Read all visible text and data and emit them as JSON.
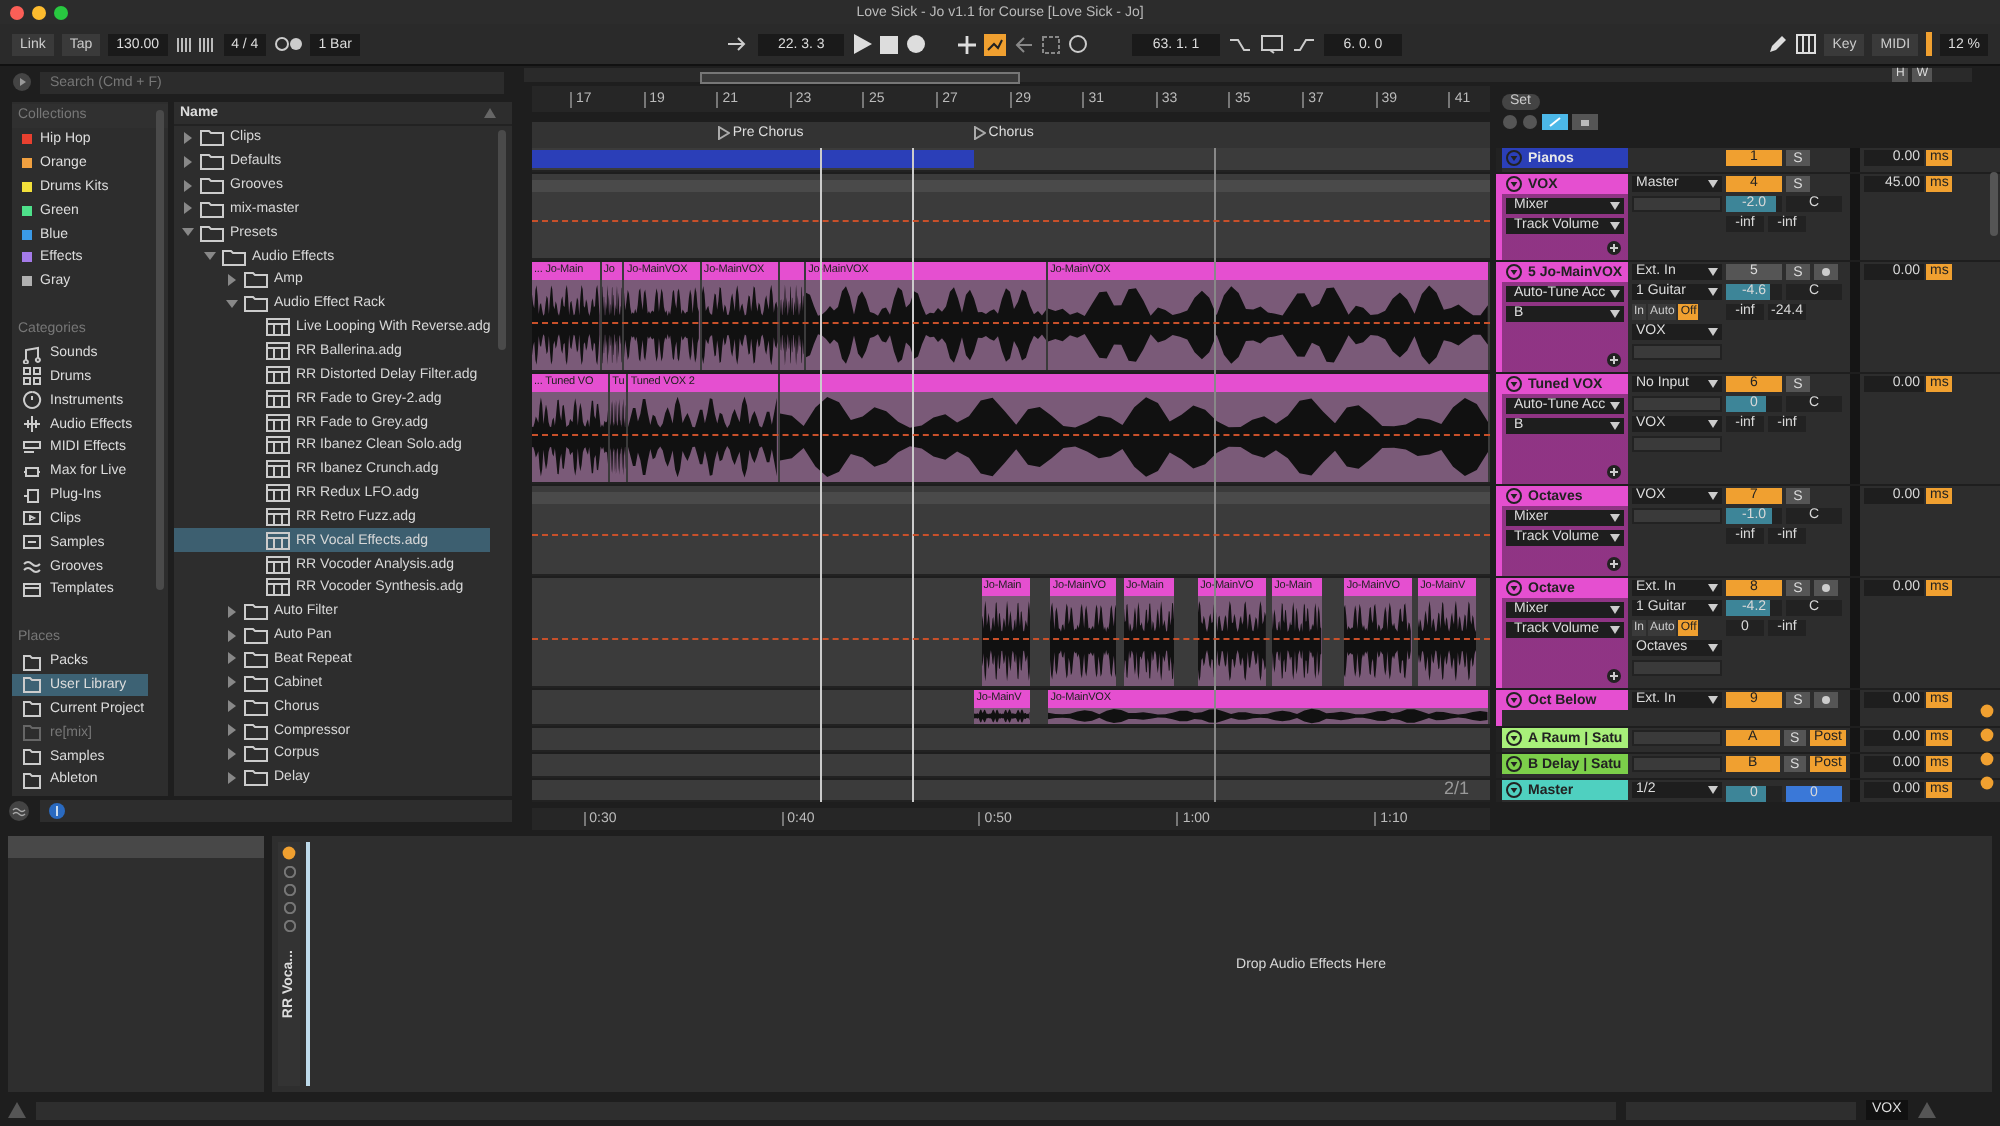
{
  "window": {
    "title": "Love Sick - Jo v1.1 for Course  [Love Sick - Jo]"
  },
  "control_bar": {
    "link": "Link",
    "tap": "Tap",
    "tempo": "130.00",
    "signature": "4 / 4",
    "quantize": "1 Bar",
    "position": "22. 3. 3",
    "loop_start": "63. 1. 1",
    "loop_length": "6. 0. 0",
    "key": "Key",
    "midi": "MIDI",
    "cpu": "12 %"
  },
  "browser": {
    "search": {
      "placeholder": "Search (Cmd + F)"
    },
    "collections_heading": "Collections",
    "collections": [
      {
        "label": "Hip Hop",
        "color": "#e8402f"
      },
      {
        "label": "Orange",
        "color": "#f0a040"
      },
      {
        "label": "Drums Kits",
        "color": "#f2e03a"
      },
      {
        "label": "Green",
        "color": "#4ee08a"
      },
      {
        "label": "Blue",
        "color": "#3a9ae8"
      },
      {
        "label": "Effects",
        "color": "#a47ae8"
      },
      {
        "label": "Gray",
        "color": "#b0b0b0"
      }
    ],
    "categories_heading": "Categories",
    "categories": [
      {
        "label": "Sounds",
        "kind": "sounds"
      },
      {
        "label": "Drums",
        "kind": "drums"
      },
      {
        "label": "Instruments",
        "kind": "instruments"
      },
      {
        "label": "Audio Effects",
        "kind": "audio"
      },
      {
        "label": "MIDI Effects",
        "kind": "midi"
      },
      {
        "label": "Max for Live",
        "kind": "max"
      },
      {
        "label": "Plug-Ins",
        "kind": "plugins"
      },
      {
        "label": "Clips",
        "kind": "clips"
      },
      {
        "label": "Samples",
        "kind": "samples"
      },
      {
        "label": "Grooves",
        "kind": "grooves"
      },
      {
        "label": "Templates",
        "kind": "templates"
      }
    ],
    "places_heading": "Places",
    "places": [
      {
        "label": "Packs",
        "selected": false,
        "disabled": false
      },
      {
        "label": "User Library",
        "selected": true,
        "disabled": false
      },
      {
        "label": "Current Project",
        "selected": false,
        "disabled": false
      },
      {
        "label": "re[mix]",
        "selected": false,
        "disabled": true
      },
      {
        "label": "Samples",
        "selected": false,
        "disabled": false
      },
      {
        "label": "Ableton",
        "selected": false,
        "disabled": false
      }
    ],
    "name_column": "Name",
    "tree": [
      {
        "label": "Clips",
        "kind": "folder",
        "expanded": false,
        "selected": false
      },
      {
        "label": "Defaults",
        "kind": "folder",
        "expanded": false,
        "selected": false
      },
      {
        "label": "Grooves",
        "kind": "folder",
        "expanded": false,
        "selected": false
      },
      {
        "label": "mix-master",
        "kind": "folder",
        "expanded": false,
        "selected": false
      },
      {
        "label": "Presets",
        "kind": "folder",
        "expanded": true,
        "selected": false,
        "children": [
          {
            "label": "Audio Effects",
            "kind": "folder",
            "expanded": true,
            "selected": false,
            "children": [
              {
                "label": "Amp",
                "kind": "folder",
                "expanded": false,
                "selected": false
              },
              {
                "label": "Audio Effect Rack",
                "kind": "folder",
                "expanded": true,
                "selected": false,
                "children": [
                  {
                    "label": "Live Looping With Reverse.adg",
                    "kind": "preset",
                    "selected": false
                  },
                  {
                    "label": "RR Ballerina.adg",
                    "kind": "preset",
                    "selected": false
                  },
                  {
                    "label": "RR Distorted Delay Filter.adg",
                    "kind": "preset",
                    "selected": false
                  },
                  {
                    "label": "RR Fade to Grey-2.adg",
                    "kind": "preset",
                    "selected": false
                  },
                  {
                    "label": "RR Fade to Grey.adg",
                    "kind": "preset",
                    "selected": false
                  },
                  {
                    "label": "RR Ibanez Clean Solo.adg",
                    "kind": "preset",
                    "selected": false
                  },
                  {
                    "label": "RR Ibanez Crunch.adg",
                    "kind": "preset",
                    "selected": false
                  },
                  {
                    "label": "RR Redux LFO.adg",
                    "kind": "preset",
                    "selected": false
                  },
                  {
                    "label": "RR Retro Fuzz.adg",
                    "kind": "preset",
                    "selected": false
                  },
                  {
                    "label": "RR Vocal Effects.adg",
                    "kind": "preset",
                    "selected": true
                  },
                  {
                    "label": "RR Vocoder Analysis.adg",
                    "kind": "preset",
                    "selected": false
                  },
                  {
                    "label": "RR Vocoder Synthesis.adg",
                    "kind": "preset",
                    "selected": false
                  }
                ]
              },
              {
                "label": "Auto Filter",
                "kind": "folder",
                "expanded": false,
                "selected": false
              },
              {
                "label": "Auto Pan",
                "kind": "folder",
                "expanded": false,
                "selected": false
              },
              {
                "label": "Beat Repeat",
                "kind": "folder",
                "expanded": false,
                "selected": false
              },
              {
                "label": "Cabinet",
                "kind": "folder",
                "expanded": false,
                "selected": false
              },
              {
                "label": "Chorus",
                "kind": "folder",
                "expanded": false,
                "selected": false
              },
              {
                "label": "Compressor",
                "kind": "folder",
                "expanded": false,
                "selected": false
              },
              {
                "label": "Corpus",
                "kind": "folder",
                "expanded": false,
                "selected": false
              },
              {
                "label": "Delay",
                "kind": "folder",
                "expanded": false,
                "selected": false
              }
            ]
          }
        ]
      }
    ]
  },
  "arrangement": {
    "bars": [
      "17",
      "19",
      "21",
      "23",
      "25",
      "27",
      "29",
      "31",
      "33",
      "35",
      "37",
      "39",
      "41"
    ],
    "locators": [
      {
        "label": "Pre Chorus"
      },
      {
        "label": "Chorus"
      }
    ],
    "times": [
      "0:30",
      "0:40",
      "0:50",
      "1:00",
      "1:10"
    ],
    "zoom_label": "2/1",
    "set_button": "Set",
    "height_button": "H",
    "width_button": "W"
  },
  "tracks": [
    {
      "name": "Pianos",
      "kind": "midi",
      "color": "#2b3fb8",
      "number": "1",
      "active": true,
      "solo": "S",
      "delay": "0.00",
      "delay_unit": "ms"
    },
    {
      "name": "VOX",
      "kind": "group",
      "color": "#e54fd0",
      "number": "4",
      "active": true,
      "solo": "S",
      "devices": [
        "Mixer",
        "Track Volume"
      ],
      "routing": [
        {
          "kind": "dropdown",
          "label": "Master"
        },
        {
          "kind": "blank"
        }
      ],
      "volume": {
        "value": "-2.0",
        "level": 0.88
      },
      "pan": "C",
      "sends": [
        "-inf",
        "-inf"
      ],
      "delay": "45.00",
      "delay_unit": "ms"
    },
    {
      "name": "5 Jo-MainVOX",
      "kind": "audio",
      "color": "#e54fd0",
      "number": "5",
      "active": false,
      "solo": "S",
      "armed": false,
      "devices": [
        "Auto-Tune Acc",
        "B"
      ],
      "routing": [
        {
          "kind": "dropdown",
          "label": "Ext. In"
        },
        {
          "kind": "dropdown",
          "label": "1 Guitar"
        },
        {
          "kind": "monitor",
          "options": [
            {
              "label": "In",
              "selected": false
            },
            {
              "label": "Auto",
              "selected": false
            },
            {
              "label": "Off",
              "selected": true
            }
          ]
        },
        {
          "kind": "dropdown",
          "label": "VOX"
        },
        {
          "kind": "blank"
        }
      ],
      "volume": {
        "value": "-4.6",
        "level": 0.78
      },
      "pan": "C",
      "sends": [
        "-inf",
        "-24.4"
      ],
      "delay": "0.00",
      "delay_unit": "ms",
      "clips": [
        "... Jo-Main",
        "Jo",
        "Jo-MainVOX",
        "Jo-MainVOX",
        "Jo-MainVOX",
        "Jo-MainVOX"
      ]
    },
    {
      "name": "Tuned VOX",
      "kind": "audio",
      "color": "#e54fd0",
      "number": "6",
      "active": true,
      "solo": "S",
      "devices": [
        "Auto-Tune Acc",
        "B"
      ],
      "routing": [
        {
          "kind": "dropdown",
          "label": "No Input"
        },
        {
          "kind": "blank"
        },
        {
          "kind": "dropdown",
          "label": "VOX"
        },
        {
          "kind": "blank"
        }
      ],
      "volume": {
        "value": "0",
        "level": 0.7
      },
      "pan": "C",
      "sends": [
        "-inf",
        "-inf"
      ],
      "delay": "0.00",
      "delay_unit": "ms",
      "clips": [
        "... Tuned VO",
        "Tu",
        "Tuned VOX 2"
      ]
    },
    {
      "name": "Octaves",
      "kind": "group",
      "color": "#e54fd0",
      "number": "7",
      "active": true,
      "solo": "S",
      "devices": [
        "Mixer",
        "Track Volume"
      ],
      "routing": [
        {
          "kind": "dropdown",
          "label": "VOX"
        },
        {
          "kind": "blank"
        }
      ],
      "volume": {
        "value": "-1.0",
        "level": 0.82
      },
      "pan": "C",
      "sends": [
        "-inf",
        "-inf"
      ],
      "delay": "0.00",
      "delay_unit": "ms"
    },
    {
      "name": "Octave",
      "kind": "audio",
      "color": "#e54fd0",
      "number": "8",
      "active": true,
      "solo": "S",
      "armed": false,
      "devices": [
        "Mixer",
        "Track Volume"
      ],
      "routing": [
        {
          "kind": "dropdown",
          "label": "Ext. In"
        },
        {
          "kind": "dropdown",
          "label": "1 Guitar"
        },
        {
          "kind": "monitor",
          "options": [
            {
              "label": "In",
              "selected": false
            },
            {
              "label": "Auto",
              "selected": false
            },
            {
              "label": "Off",
              "selected": true
            }
          ]
        },
        {
          "kind": "dropdown",
          "label": "Octaves"
        },
        {
          "kind": "blank"
        }
      ],
      "volume": {
        "value": "-4.2",
        "level": 0.8
      },
      "pan": "C",
      "sends": [
        "0",
        "-inf"
      ],
      "delay": "0.00",
      "delay_unit": "ms",
      "clips": [
        "Jo-Main",
        "Jo-MainVO",
        "Jo-Main",
        "Jo-MainVO",
        "Jo-Main",
        "Jo-MainVO",
        "Jo-MainV"
      ]
    },
    {
      "name": "Oct Below",
      "kind": "audio",
      "color": "#e54fd0",
      "number": "9",
      "active": true,
      "solo": "S",
      "armed": false,
      "routing": [
        {
          "kind": "dropdown",
          "label": "Ext. In"
        }
      ],
      "delay": "0.00",
      "delay_unit": "ms",
      "clips": [
        "Jo-MainV",
        "Jo-MainVOX"
      ]
    },
    {
      "name": "A Raum | Satu",
      "kind": "return",
      "color": "#a8f07a",
      "number": "A",
      "active": true,
      "solo": "S",
      "post": "Post",
      "routing": [
        {
          "kind": "blank"
        }
      ],
      "delay": "0.00",
      "delay_unit": "ms"
    },
    {
      "name": "B Delay | Satu",
      "kind": "return",
      "color": "#7ccf4a",
      "number": "B",
      "active": true,
      "solo": "S",
      "post": "Post",
      "routing": [
        {
          "kind": "blank"
        }
      ],
      "delay": "0.00",
      "delay_unit": "ms"
    },
    {
      "name": "Master",
      "kind": "master",
      "color": "#4fd0c0",
      "routing": [
        {
          "kind": "dropdown",
          "label": "1/2"
        }
      ],
      "volume": {
        "value": "0",
        "level": 0.7
      },
      "pan": "0",
      "delay": "0.00",
      "delay_unit": "ms"
    }
  ],
  "detail": {
    "device_title": "RR Voca...",
    "drop_hint": "Drop Audio Effects Here"
  },
  "status_bar": {
    "track": "VOX"
  }
}
